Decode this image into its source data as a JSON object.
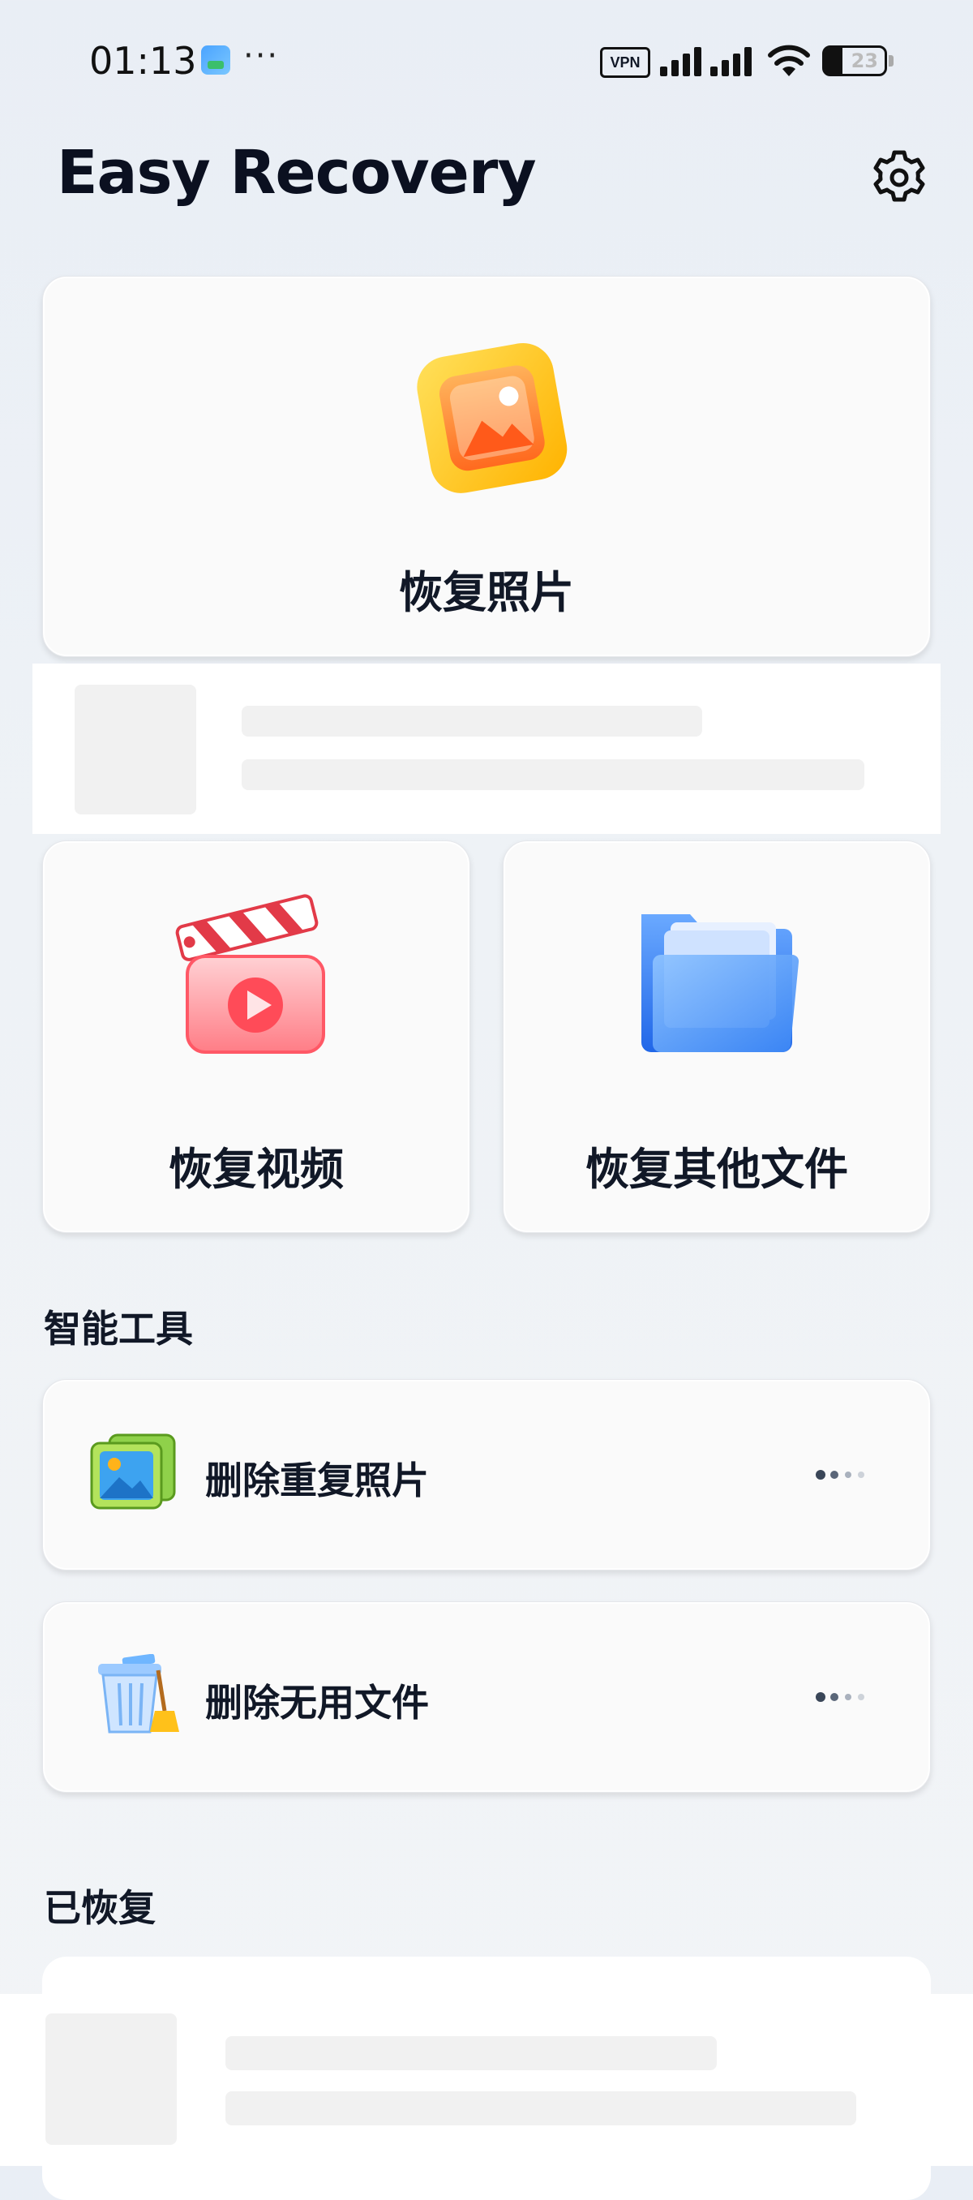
{
  "status_bar": {
    "time": "01:13",
    "more_indicator": "···",
    "vpn_label": "VPN",
    "battery_level": "23",
    "icons": [
      "app-notification-icon",
      "vpn-icon",
      "signal-icon",
      "wifi-icon",
      "battery-icon"
    ]
  },
  "header": {
    "title": "Easy Recovery",
    "settings_icon": "gear-icon"
  },
  "main_actions": [
    {
      "label": "恢复照片",
      "icon": "photo-icon"
    },
    {
      "label": "恢复视频",
      "icon": "video-clapper-icon"
    },
    {
      "label": "恢复其他文件",
      "icon": "folder-icon"
    }
  ],
  "smart_tools": {
    "title": "智能工具",
    "items": [
      {
        "label": "删除重复照片",
        "icon": "duplicate-photos-icon",
        "trailing_icon": "loading-dots-icon"
      },
      {
        "label": "删除无用文件",
        "icon": "trash-broom-icon",
        "trailing_icon": "loading-dots-icon"
      }
    ]
  },
  "recovered": {
    "title": "已恢复"
  },
  "colors": {
    "title": "#0b1020",
    "card_bg": "#fafafa",
    "placeholder": "#f1f1f1",
    "photo_orange": "#ff7a2a",
    "photo_yellow": "#ffc21a",
    "video_red": "#ef3a4a",
    "folder_blue": "#2f7bf0"
  }
}
